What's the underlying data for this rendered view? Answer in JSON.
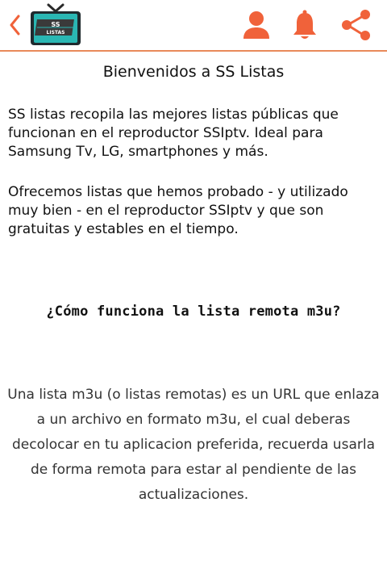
{
  "header": {
    "logo_text_top": "SS",
    "logo_text_bottom": "LISTAS",
    "accent_color": "#f0623a"
  },
  "content": {
    "title": "Bienvenidos a SS Listas",
    "paragraph1": "SS listas recopila las mejores listas públicas que funcionan en el reproductor SSIptv. Ideal para Samsung Tv, LG, smartphones y más.",
    "paragraph2": "Ofrecemos listas que hemos probado - y utilizado muy bien - en el reproductor SSIptv y que son gratuitas y estables en el tiempo.",
    "subtitle": "¿Cómo funciona la lista remota m3u?",
    "paragraph3": "Una lista m3u (o listas remotas) es un URL que enlaza a un archivo en formato m3u, el cual deberas decolocar en tu aplicacion preferida, recuerda usarla de forma remota para estar al pendiente de las actualizaciones."
  },
  "icons": [
    "back-arrow-icon",
    "tv-logo-icon",
    "user-icon",
    "bell-icon",
    "share-icon"
  ]
}
